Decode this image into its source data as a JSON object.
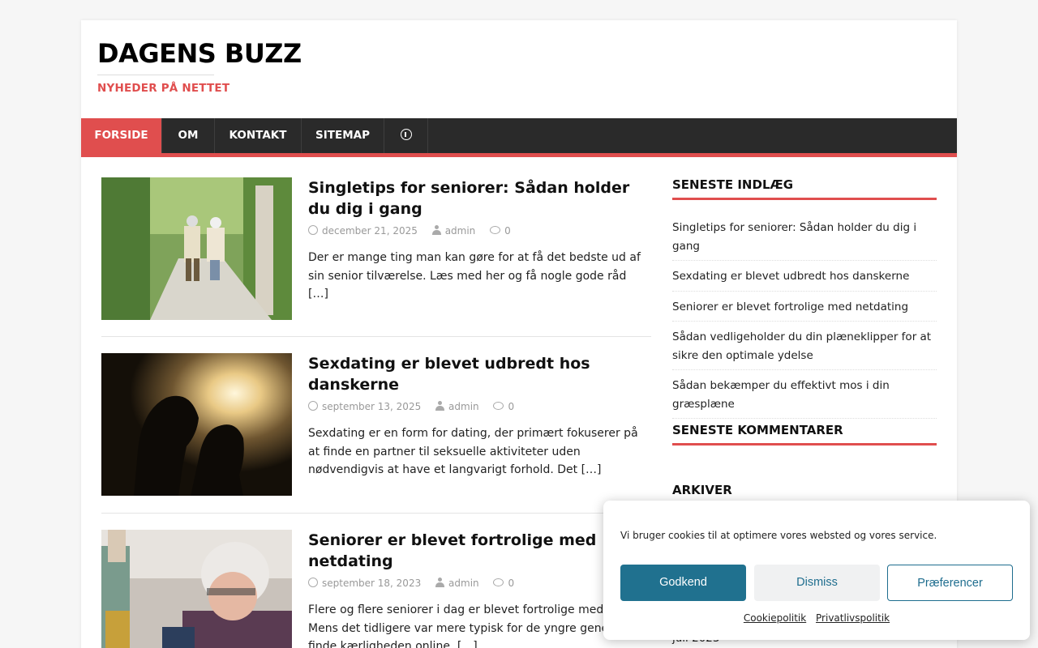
{
  "site": {
    "title": "DAGENS BUZZ",
    "tagline": "NYHEDER PÅ NETTET"
  },
  "nav": {
    "items": [
      "FORSIDE",
      "OM",
      "KONTAKT",
      "SITEMAP"
    ],
    "info_icon": "info-circle-icon"
  },
  "posts": [
    {
      "title": "Singletips for seniorer: Sådan holder du dig i gang",
      "date": "december 21, 2025",
      "author": "admin",
      "comments": "0",
      "excerpt": "Der er mange ting man kan gøre for at få det bedste ud af sin senior tilværelse. Læs med her og få nogle gode råd",
      "more": "[…]"
    },
    {
      "title": "Sexdating er blevet udbredt hos danskerne",
      "date": "september 13, 2025",
      "author": "admin",
      "comments": "0",
      "excerpt": "Sexdating er en form for dating, der primært fokuserer på at finde en partner til seksuelle aktiviteter uden nødvendigvis at have et langvarigt forhold. Det",
      "more": "[…]"
    },
    {
      "title": "Seniorer er blevet fortrolige med netdating",
      "date": "september 18, 2023",
      "author": "admin",
      "comments": "0",
      "excerpt": "Flere og flere seniorer i dag er blevet fortrolige med ne... Mens det tidligere var mere typisk for de yngre genera... at finde kærligheden online.",
      "more": "[…]"
    }
  ],
  "sidebar": {
    "recent_title": "SENESTE INDLÆG",
    "recent": [
      "Singletips for seniorer: Sådan holder du dig i gang",
      "Sexdating er blevet udbredt hos danskerne",
      "Seniorer er blevet fortrolige med netdating",
      "Sådan vedligeholder du din plæneklipper for at sikre den optimale ydelse",
      "Sådan bekæmper du effektivt mos i din græsplæne"
    ],
    "comments_title": "SENESTE KOMMENTARER",
    "archive_title": "ARKIVER",
    "archive_item": "juli 2023"
  },
  "cookie": {
    "text": "Vi bruger cookies til at optimere vores websted og vores service.",
    "accept": "Godkend",
    "dismiss": "Dismiss",
    "prefs": "Præferencer",
    "link1": "Cookiepolitik",
    "link2": "Privatlivspolitik"
  },
  "colors": {
    "accent": "#e04e4e",
    "nav_bg": "#2a2a2a",
    "cookie_btn": "#20718f"
  }
}
